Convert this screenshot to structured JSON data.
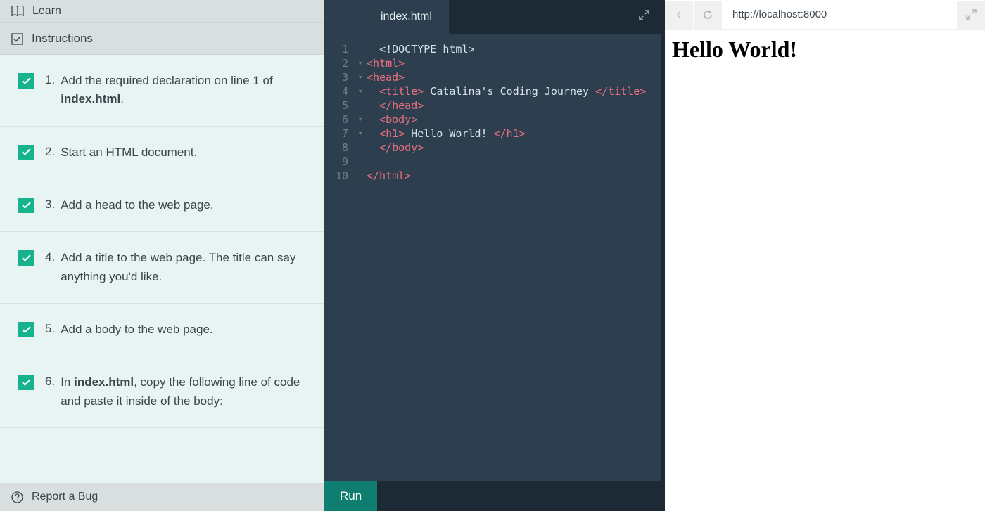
{
  "left": {
    "learn_label": "Learn",
    "instructions_label": "Instructions",
    "tasks": [
      {
        "num": "1.",
        "html": "Add the required declaration on line 1 of <b>index.html</b>."
      },
      {
        "num": "2.",
        "html": "Start an HTML document."
      },
      {
        "num": "3.",
        "html": "Add a head to the web page."
      },
      {
        "num": "4.",
        "html": "Add a title to the web page. The title can say anything you'd like."
      },
      {
        "num": "5.",
        "html": "Add a body to the web page."
      },
      {
        "num": "6.",
        "html": "In <b>index.html</b>, copy the following line of code and paste it inside of the body:"
      }
    ],
    "report_bug_label": "Report a Bug"
  },
  "editor": {
    "tab_label": "index.html",
    "lines": [
      {
        "n": "1",
        "fold": "",
        "segs": [
          {
            "t": "  ",
            "c": ""
          },
          {
            "t": "<!DOCTYPE html>",
            "c": "txt-c"
          }
        ]
      },
      {
        "n": "2",
        "fold": "▾",
        "segs": [
          {
            "t": "<html>",
            "c": "tag"
          }
        ]
      },
      {
        "n": "3",
        "fold": "▾",
        "segs": [
          {
            "t": "<head>",
            "c": "tag"
          }
        ]
      },
      {
        "n": "4",
        "fold": "▾",
        "segs": [
          {
            "t": "  ",
            "c": ""
          },
          {
            "t": "<title>",
            "c": "tag"
          },
          {
            "t": " Catalina's Coding Journey ",
            "c": "txt-c"
          },
          {
            "t": "</title>",
            "c": "tag"
          }
        ]
      },
      {
        "n": "5",
        "fold": "",
        "segs": [
          {
            "t": "  ",
            "c": ""
          },
          {
            "t": "</head>",
            "c": "tag"
          }
        ]
      },
      {
        "n": "6",
        "fold": "▾",
        "segs": [
          {
            "t": "  ",
            "c": ""
          },
          {
            "t": "<body>",
            "c": "tag"
          }
        ]
      },
      {
        "n": "7",
        "fold": "▾",
        "segs": [
          {
            "t": "  ",
            "c": ""
          },
          {
            "t": "<h1>",
            "c": "tag"
          },
          {
            "t": " Hello World! ",
            "c": "txt-c"
          },
          {
            "t": "</h1>",
            "c": "tag"
          }
        ]
      },
      {
        "n": "8",
        "fold": "",
        "segs": [
          {
            "t": "  ",
            "c": ""
          },
          {
            "t": "</body>",
            "c": "tag"
          }
        ]
      },
      {
        "n": "9",
        "fold": "",
        "segs": []
      },
      {
        "n": "10",
        "fold": "",
        "segs": [
          {
            "t": "</html>",
            "c": "tag"
          }
        ]
      }
    ],
    "run_label": "Run"
  },
  "preview": {
    "url": "http://localhost:8000",
    "heading": "Hello World!"
  }
}
